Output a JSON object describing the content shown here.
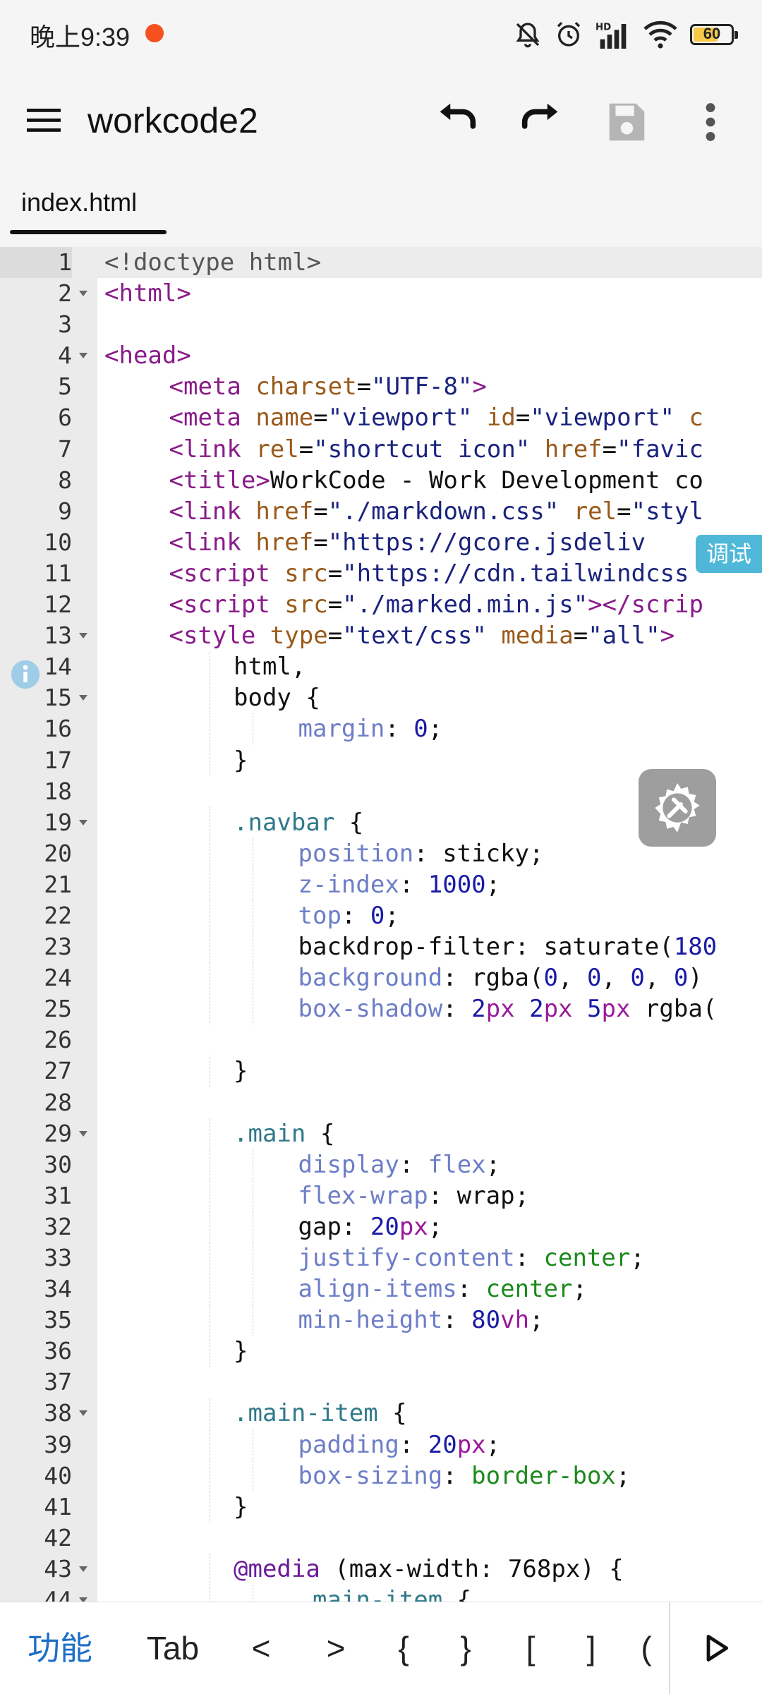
{
  "status_bar": {
    "time": "晚上9:39",
    "battery": "60"
  },
  "app_bar": {
    "title": "workcode2"
  },
  "tabs": [
    {
      "label": "index.html",
      "active": true
    }
  ],
  "editor": {
    "active_line": 1,
    "lines": [
      {
        "n": 1,
        "fold": false,
        "indent": 0,
        "tokens": [
          [
            "cm",
            "<!doctype html>"
          ]
        ]
      },
      {
        "n": 2,
        "fold": true,
        "indent": 0,
        "tokens": [
          [
            "tag",
            "<html>"
          ]
        ]
      },
      {
        "n": 3,
        "fold": false,
        "indent": 0,
        "tokens": []
      },
      {
        "n": 4,
        "fold": true,
        "indent": 0,
        "tokens": [
          [
            "tag",
            "<head>"
          ]
        ]
      },
      {
        "n": 5,
        "fold": false,
        "indent": 1,
        "tokens": [
          [
            "tag",
            "<meta "
          ],
          [
            "attr",
            "charset"
          ],
          [
            "plain",
            "="
          ],
          [
            "str",
            "\"UTF-8\""
          ],
          [
            "tag",
            ">"
          ]
        ]
      },
      {
        "n": 6,
        "fold": false,
        "indent": 1,
        "tokens": [
          [
            "tag",
            "<meta "
          ],
          [
            "attr",
            "name"
          ],
          [
            "plain",
            "="
          ],
          [
            "str",
            "\"viewport\""
          ],
          [
            "plain",
            " "
          ],
          [
            "attr",
            "id"
          ],
          [
            "plain",
            "="
          ],
          [
            "str",
            "\"viewport\""
          ],
          [
            "plain",
            " "
          ],
          [
            "attr",
            "c"
          ]
        ]
      },
      {
        "n": 7,
        "fold": false,
        "indent": 1,
        "tokens": [
          [
            "tag",
            "<link "
          ],
          [
            "attr",
            "rel"
          ],
          [
            "plain",
            "="
          ],
          [
            "str",
            "\"shortcut icon\""
          ],
          [
            "plain",
            " "
          ],
          [
            "attr",
            "href"
          ],
          [
            "plain",
            "="
          ],
          [
            "str",
            "\"favic"
          ]
        ]
      },
      {
        "n": 8,
        "fold": false,
        "indent": 1,
        "tokens": [
          [
            "tag",
            "<title>"
          ],
          [
            "plain",
            "WorkCode - Work Development co"
          ]
        ]
      },
      {
        "n": 9,
        "fold": false,
        "indent": 1,
        "tokens": [
          [
            "tag",
            "<link "
          ],
          [
            "attr",
            "href"
          ],
          [
            "plain",
            "="
          ],
          [
            "str",
            "\"./markdown.css\""
          ],
          [
            "plain",
            " "
          ],
          [
            "attr",
            "rel"
          ],
          [
            "plain",
            "="
          ],
          [
            "str",
            "\"styl"
          ]
        ]
      },
      {
        "n": 10,
        "fold": false,
        "indent": 1,
        "tokens": [
          [
            "tag",
            "<link "
          ],
          [
            "attr",
            "href"
          ],
          [
            "plain",
            "="
          ],
          [
            "str",
            "\"https://gcore.jsdeliv"
          ]
        ]
      },
      {
        "n": 11,
        "fold": false,
        "indent": 1,
        "tokens": [
          [
            "tag",
            "<script "
          ],
          [
            "attr",
            "src"
          ],
          [
            "plain",
            "="
          ],
          [
            "str",
            "\"https://cdn.tailwindcss"
          ]
        ]
      },
      {
        "n": 12,
        "fold": false,
        "indent": 1,
        "tokens": [
          [
            "tag",
            "<script "
          ],
          [
            "attr",
            "src"
          ],
          [
            "plain",
            "="
          ],
          [
            "str",
            "\"./marked.min.js\""
          ],
          [
            "tag",
            "></scrip"
          ]
        ]
      },
      {
        "n": 13,
        "fold": true,
        "indent": 1,
        "tokens": [
          [
            "tag",
            "<style "
          ],
          [
            "attr",
            "type"
          ],
          [
            "plain",
            "="
          ],
          [
            "str",
            "\"text/css\""
          ],
          [
            "plain",
            " "
          ],
          [
            "attr",
            "media"
          ],
          [
            "plain",
            "="
          ],
          [
            "str",
            "\"all\""
          ],
          [
            "tag",
            ">"
          ]
        ]
      },
      {
        "n": 14,
        "fold": false,
        "indent": 2,
        "tokens": [
          [
            "plain",
            "html,"
          ]
        ]
      },
      {
        "n": 15,
        "fold": true,
        "indent": 2,
        "tokens": [
          [
            "plain",
            "body {"
          ]
        ]
      },
      {
        "n": 16,
        "fold": false,
        "indent": 3,
        "tokens": [
          [
            "prop",
            "margin"
          ],
          [
            "plain",
            ": "
          ],
          [
            "num",
            "0"
          ],
          [
            "plain",
            ";"
          ]
        ]
      },
      {
        "n": 17,
        "fold": false,
        "indent": 2,
        "tokens": [
          [
            "plain",
            "}"
          ]
        ]
      },
      {
        "n": 18,
        "fold": false,
        "indent": 0,
        "tokens": []
      },
      {
        "n": 19,
        "fold": true,
        "indent": 2,
        "tokens": [
          [
            "sel",
            ".navbar"
          ],
          [
            "plain",
            " {"
          ]
        ]
      },
      {
        "n": 20,
        "fold": false,
        "indent": 3,
        "tokens": [
          [
            "prop",
            "position"
          ],
          [
            "plain",
            ": sticky;"
          ]
        ]
      },
      {
        "n": 21,
        "fold": false,
        "indent": 3,
        "tokens": [
          [
            "prop",
            "z-index"
          ],
          [
            "plain",
            ": "
          ],
          [
            "num",
            "1000"
          ],
          [
            "plain",
            ";"
          ]
        ]
      },
      {
        "n": 22,
        "fold": false,
        "indent": 3,
        "tokens": [
          [
            "prop",
            "top"
          ],
          [
            "plain",
            ": "
          ],
          [
            "num",
            "0"
          ],
          [
            "plain",
            ";"
          ]
        ]
      },
      {
        "n": 23,
        "fold": false,
        "indent": 3,
        "tokens": [
          [
            "plain",
            "backdrop-filter: saturate("
          ],
          [
            "num",
            "180"
          ]
        ]
      },
      {
        "n": 24,
        "fold": false,
        "indent": 3,
        "tokens": [
          [
            "prop",
            "background"
          ],
          [
            "plain",
            ": rgba("
          ],
          [
            "num",
            "0"
          ],
          [
            "plain",
            ", "
          ],
          [
            "num",
            "0"
          ],
          [
            "plain",
            ", "
          ],
          [
            "num",
            "0"
          ],
          [
            "plain",
            ", "
          ],
          [
            "num",
            "0"
          ],
          [
            "plain",
            ")"
          ]
        ]
      },
      {
        "n": 25,
        "fold": false,
        "indent": 3,
        "tokens": [
          [
            "prop",
            "box-shadow"
          ],
          [
            "plain",
            ": "
          ],
          [
            "num",
            "2"
          ],
          [
            "unit",
            "px"
          ],
          [
            "plain",
            " "
          ],
          [
            "num",
            "2"
          ],
          [
            "unit",
            "px"
          ],
          [
            "plain",
            " "
          ],
          [
            "num",
            "5"
          ],
          [
            "unit",
            "px"
          ],
          [
            "plain",
            " rgba("
          ]
        ]
      },
      {
        "n": 26,
        "fold": false,
        "indent": 0,
        "tokens": []
      },
      {
        "n": 27,
        "fold": false,
        "indent": 2,
        "tokens": [
          [
            "plain",
            "}"
          ]
        ]
      },
      {
        "n": 28,
        "fold": false,
        "indent": 0,
        "tokens": []
      },
      {
        "n": 29,
        "fold": true,
        "indent": 2,
        "tokens": [
          [
            "sel",
            ".main"
          ],
          [
            "plain",
            " {"
          ]
        ]
      },
      {
        "n": 30,
        "fold": false,
        "indent": 3,
        "tokens": [
          [
            "prop",
            "display"
          ],
          [
            "plain",
            ": "
          ],
          [
            "prop",
            "flex"
          ],
          [
            "plain",
            ";"
          ]
        ]
      },
      {
        "n": 31,
        "fold": false,
        "indent": 3,
        "tokens": [
          [
            "prop",
            "flex-wrap"
          ],
          [
            "plain",
            ": wrap;"
          ]
        ]
      },
      {
        "n": 32,
        "fold": false,
        "indent": 3,
        "tokens": [
          [
            "plain",
            "gap: "
          ],
          [
            "num",
            "20"
          ],
          [
            "unit",
            "px"
          ],
          [
            "plain",
            ";"
          ]
        ]
      },
      {
        "n": 33,
        "fold": false,
        "indent": 3,
        "tokens": [
          [
            "prop",
            "justify-content"
          ],
          [
            "plain",
            ": "
          ],
          [
            "kw",
            "center"
          ],
          [
            "plain",
            ";"
          ]
        ]
      },
      {
        "n": 34,
        "fold": false,
        "indent": 3,
        "tokens": [
          [
            "prop",
            "align-items"
          ],
          [
            "plain",
            ": "
          ],
          [
            "kw",
            "center"
          ],
          [
            "plain",
            ";"
          ]
        ]
      },
      {
        "n": 35,
        "fold": false,
        "indent": 3,
        "tokens": [
          [
            "prop",
            "min-height"
          ],
          [
            "plain",
            ": "
          ],
          [
            "num",
            "80"
          ],
          [
            "unit",
            "vh"
          ],
          [
            "plain",
            ";"
          ]
        ]
      },
      {
        "n": 36,
        "fold": false,
        "indent": 2,
        "tokens": [
          [
            "plain",
            "}"
          ]
        ]
      },
      {
        "n": 37,
        "fold": false,
        "indent": 0,
        "tokens": []
      },
      {
        "n": 38,
        "fold": true,
        "indent": 2,
        "tokens": [
          [
            "sel",
            ".main-item"
          ],
          [
            "plain",
            " {"
          ]
        ]
      },
      {
        "n": 39,
        "fold": false,
        "indent": 3,
        "tokens": [
          [
            "prop",
            "padding"
          ],
          [
            "plain",
            ": "
          ],
          [
            "num",
            "20"
          ],
          [
            "unit",
            "px"
          ],
          [
            "plain",
            ";"
          ]
        ]
      },
      {
        "n": 40,
        "fold": false,
        "indent": 3,
        "tokens": [
          [
            "prop",
            "box-sizing"
          ],
          [
            "plain",
            ": "
          ],
          [
            "kw",
            "border-box"
          ],
          [
            "plain",
            ";"
          ]
        ]
      },
      {
        "n": 41,
        "fold": false,
        "indent": 2,
        "tokens": [
          [
            "plain",
            "}"
          ]
        ]
      },
      {
        "n": 42,
        "fold": false,
        "indent": 0,
        "tokens": []
      },
      {
        "n": 43,
        "fold": true,
        "indent": 2,
        "tokens": [
          [
            "at",
            "@media"
          ],
          [
            "plain",
            " (max-width: 768px) {"
          ]
        ]
      },
      {
        "n": 44,
        "fold": true,
        "indent": 3,
        "tokens": [
          [
            "sel",
            ".main-item"
          ],
          [
            "plain",
            " {"
          ]
        ]
      }
    ]
  },
  "floating": {
    "debug_label": "调试"
  },
  "bottom_bar": {
    "keys": [
      "功能",
      "Tab",
      "<",
      ">",
      "{",
      "}",
      "[",
      "]",
      "("
    ]
  }
}
